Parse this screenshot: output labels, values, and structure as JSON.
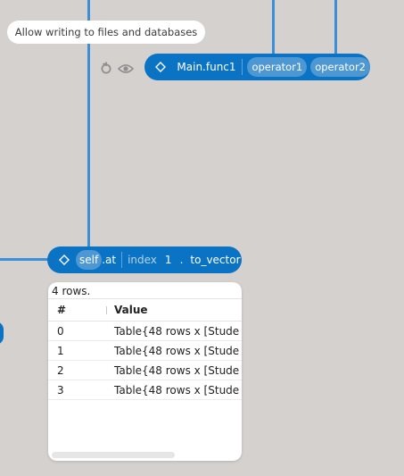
{
  "tooltip": {
    "text": "Allow writing to files and databases"
  },
  "node_main": {
    "icons": [
      "refresh-icon",
      "eye-icon"
    ],
    "name": "Main.func1",
    "args": [
      "operator1",
      "operator2"
    ]
  },
  "node_self": {
    "self_label": "self",
    "rest_label": ".at",
    "kw": "index",
    "num": "1",
    "dot": ".",
    "method": "to_vector"
  },
  "table": {
    "rows_count": "4 rows.",
    "headers": [
      "#",
      "Value"
    ],
    "rows": [
      [
        "0",
        "Table{48 rows x [Stude"
      ],
      [
        "1",
        "Table{48 rows x [Stude"
      ],
      [
        "2",
        "Table{48 rows x [Stude"
      ],
      [
        "3",
        "Table{48 rows x [Stude"
      ]
    ]
  },
  "colors": {
    "node": "#0b73c4",
    "wire": "#3a8fd8",
    "background": "#d5d1cf"
  }
}
